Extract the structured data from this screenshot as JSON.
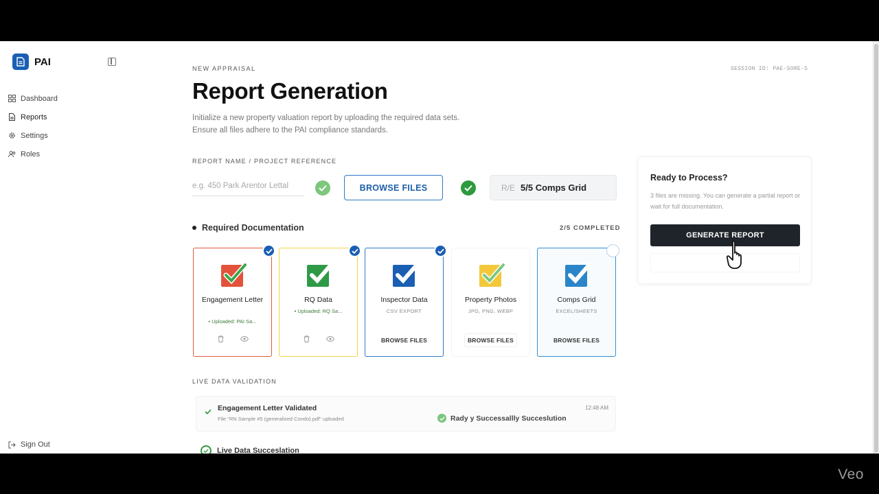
{
  "colors": {
    "primary": "#1a5fb4",
    "success": "#2e9a3e",
    "dark_button": "#1f242b",
    "card_red": "#e3573d",
    "card_yellow": "#f0d34c",
    "card_blue": "#2f78c4"
  },
  "sidebar": {
    "brand": "PAI",
    "items": [
      {
        "label": "Dashboard",
        "icon": "grid-icon"
      },
      {
        "label": "Reports",
        "icon": "document-icon"
      },
      {
        "label": "Settings",
        "icon": "gear-icon"
      },
      {
        "label": "Roles",
        "icon": "users-icon"
      }
    ],
    "sign_out": "Sign Out"
  },
  "header": {
    "kicker": "NEW APPRAISAL",
    "title": "Report Generation",
    "desc_line1": "Initialize a new property valuation report by uploading the required data sets.",
    "desc_line2": "Ensure all files adhere to the PAI compliance standards.",
    "session": "SESSION ID: PAE-SORE-S"
  },
  "form": {
    "field_label": "REPORT NAME / PROJECT REFERENCE",
    "ref_placeholder": "e.g. 450 Park Arentor Lettal",
    "browse_label": "BROWSE FILES",
    "status_ghost": "R/E",
    "status_text": "5/5 Comps Grid"
  },
  "docs": {
    "section_title": "Required Documentation",
    "completed": "2/5 COMPLETED",
    "cards": [
      {
        "title": "Engagement Letter",
        "sub": "• Uploaded: PAI Sa...",
        "browse": ""
      },
      {
        "title": "RQ Data",
        "sub": "• Uploaded: RQ Sa...",
        "browse": ""
      },
      {
        "title": "Inspector Data",
        "sub": "CSV EXPORT",
        "browse": "BROWSE FILES"
      },
      {
        "title": "Property Photos",
        "sub": "JPG, PNG, WEBP",
        "browse": "BROWSE FILES"
      },
      {
        "title": "Comps Grid",
        "sub": "EXCEL/SHEETS",
        "browse": "BROWSE FILES"
      }
    ]
  },
  "live": {
    "label": "LIVE DATA VALIDATION",
    "entry_title": "Engagement Letter Validated",
    "entry_sub": "File \"RN Sample #5 (generalized Condo).pdf\" uploaded",
    "entry_time": "12:48 AM",
    "entry_success": "Rady y Successallly Succeslution",
    "second_title": "Live Data Succeslation"
  },
  "panel": {
    "title": "Ready to Process?",
    "desc": "3 files are missing. You can generate a partial report or wait for full documentation.",
    "button": "GENERATE REPORT"
  },
  "watermark": "Veo"
}
